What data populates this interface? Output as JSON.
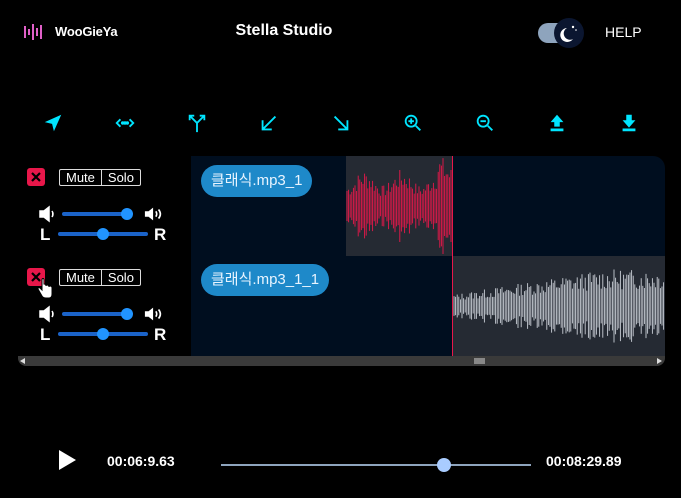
{
  "header": {
    "brand": "WooGieYa",
    "title": "Stella Studio",
    "help": "HELP",
    "dark_mode_on": true
  },
  "toolbar": {
    "tools": [
      "cursor-icon",
      "move-horizontal-icon",
      "split-icon",
      "fade-in-icon",
      "fade-out-icon",
      "zoom-in-icon",
      "zoom-out-icon",
      "upload-icon",
      "download-icon"
    ]
  },
  "tracks": [
    {
      "clip_label": "클래식.mp3_1",
      "mute_label": "Mute",
      "solo_label": "Solo",
      "volume": 0.95,
      "pan": 0.5,
      "left_label": "L",
      "right_label": "R",
      "waveform_color": "#e8174a"
    },
    {
      "clip_label": "클래식.mp3_1_1",
      "mute_label": "Mute",
      "solo_label": "Solo",
      "volume": 0.95,
      "pan": 0.5,
      "left_label": "L",
      "right_label": "R",
      "waveform_color": "#c9ced6"
    }
  ],
  "transport": {
    "current_time": "00:06:9.63",
    "total_time": "00:08:29.89",
    "progress": 0.72
  },
  "colors": {
    "accent": "#00e5ff",
    "danger": "#e8174a",
    "clip": "#1e89c9"
  }
}
